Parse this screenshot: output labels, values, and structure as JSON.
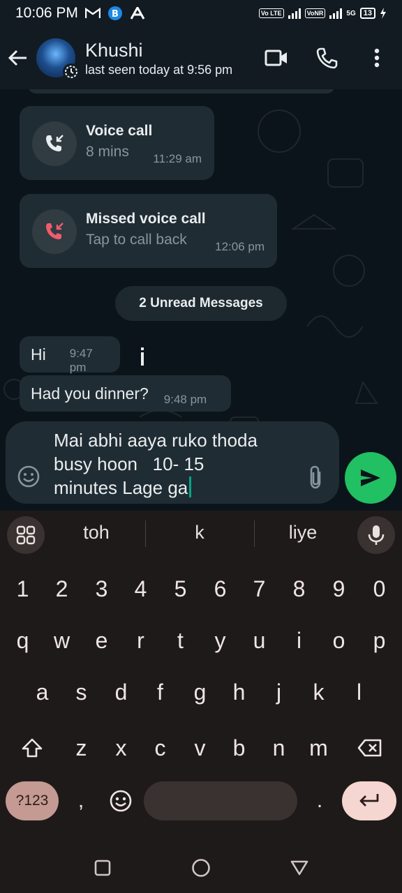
{
  "status_bar": {
    "time": "10:06 PM",
    "left_icons": [
      "gmail-icon",
      "b-app-icon",
      "airtel-icon"
    ],
    "net1": "Vo LTE",
    "net2": "VoNR",
    "net_type": "5G",
    "battery": "13"
  },
  "header": {
    "contact_name": "Khushi",
    "last_seen": "last seen today at 9:56 pm"
  },
  "calls": [
    {
      "title": "Voice call",
      "subtitle": "8 mins",
      "time": "11:29 am",
      "type": "incoming"
    },
    {
      "title": "Missed voice call",
      "subtitle": "Tap to call back",
      "time": "12:06 pm",
      "type": "missed"
    }
  ],
  "unread_label": "2 Unread Messages",
  "messages": [
    {
      "text": "Hi",
      "time": "9:47 pm"
    },
    {
      "text": "Had you dinner?",
      "time": "9:48 pm"
    }
  ],
  "composer": {
    "text": "Mai abhi aaya ruko thoda\nbusy hoon   10- 15\nminutes Lage ga"
  },
  "keyboard": {
    "suggestions": [
      "toh",
      "k",
      "liye"
    ],
    "row_numbers": [
      "1",
      "2",
      "3",
      "4",
      "5",
      "6",
      "7",
      "8",
      "9",
      "0"
    ],
    "row1": [
      "q",
      "w",
      "e",
      "r",
      "t",
      "y",
      "u",
      "i",
      "o",
      "p"
    ],
    "row2": [
      "a",
      "s",
      "d",
      "f",
      "g",
      "h",
      "j",
      "k",
      "l"
    ],
    "row3": [
      "z",
      "x",
      "c",
      "v",
      "b",
      "n",
      "m"
    ],
    "symbols_label": "?123",
    "comma": ",",
    "period": "."
  },
  "colors": {
    "accent_green": "#21c063",
    "missed_red": "#f15c6d",
    "bubble": "#202c33",
    "bg": "#0b141a"
  }
}
